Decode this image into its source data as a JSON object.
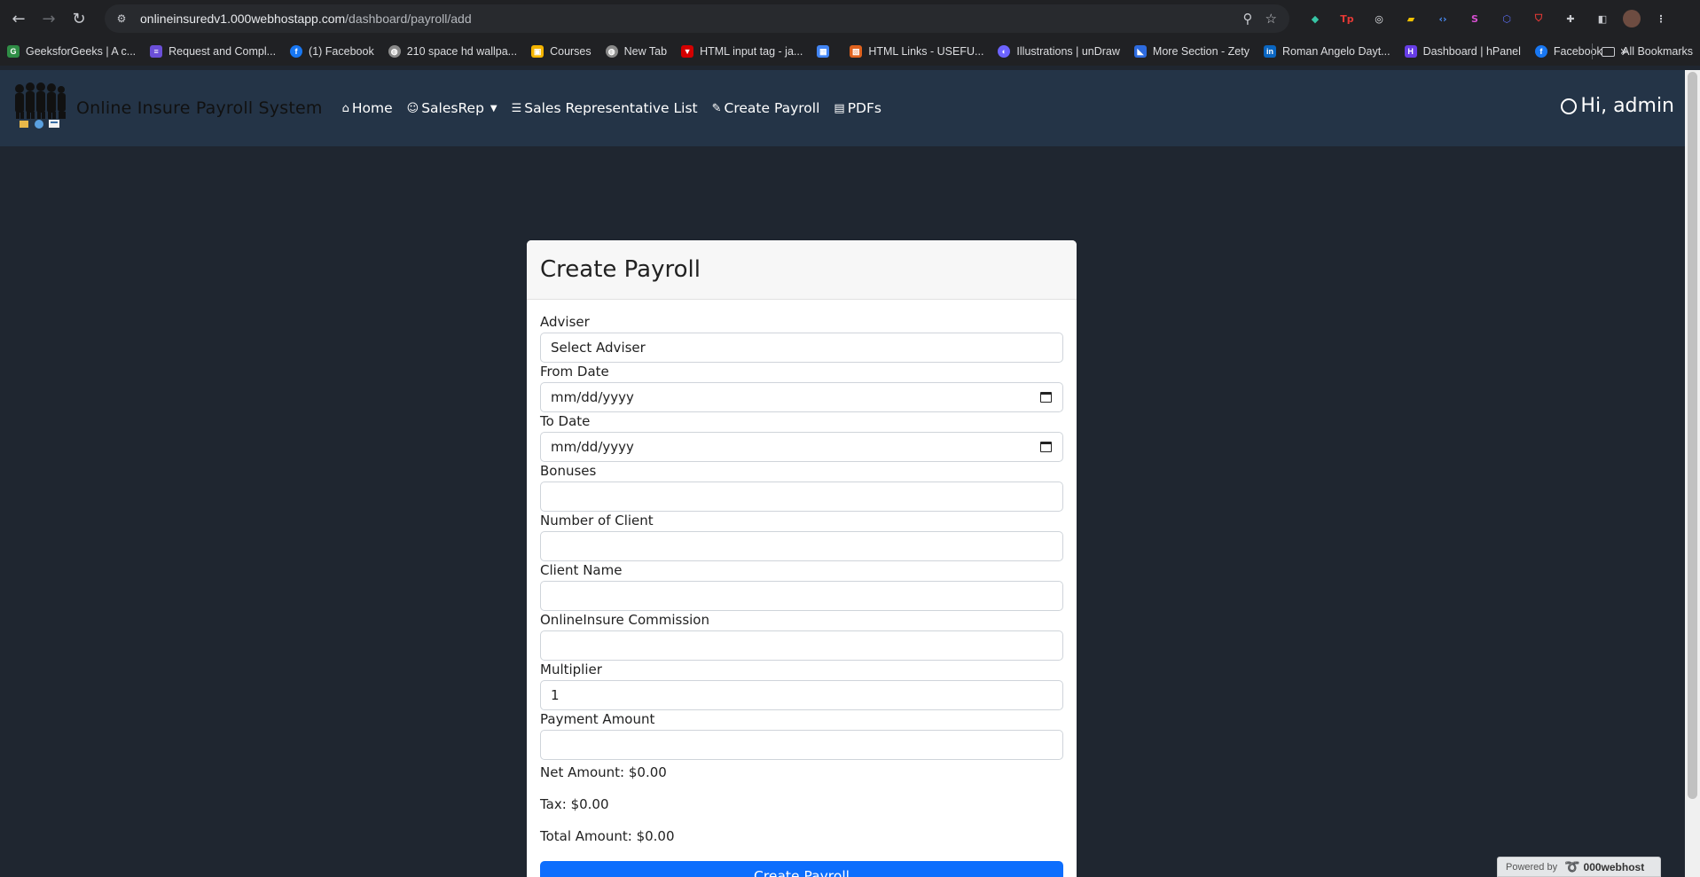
{
  "browser": {
    "url_host": "onlineinsuredv1.000webhostapp.com",
    "url_path": "/dashboard/payroll/add",
    "bookmarks": [
      {
        "label": "GeeksforGeeks | A c...",
        "color": "#2f8d46"
      },
      {
        "label": "Request and Compl...",
        "color": "#6b4fd8"
      },
      {
        "label": "(1) Facebook",
        "color": "#1877f2"
      },
      {
        "label": "210 space hd wallpa...",
        "color": "#8a8a8a"
      },
      {
        "label": "Courses",
        "color": "#f4b400"
      },
      {
        "label": "New Tab",
        "color": "#8a8a8a"
      },
      {
        "label": "HTML input tag - ja...",
        "color": "#d40000"
      },
      {
        "label": "",
        "color": "#4285f4"
      },
      {
        "label": "HTML Links - USEFU...",
        "color": "#e0621e"
      },
      {
        "label": "Illustrations | unDraw",
        "color": "#6c63ff"
      },
      {
        "label": "More Section - Zety",
        "color": "#2d6bdf"
      },
      {
        "label": "Roman Angelo Dayt...",
        "color": "#0a66c2"
      },
      {
        "label": "Dashboard | hPanel",
        "color": "#673de6"
      },
      {
        "label": "Facebook",
        "color": "#1877f2"
      }
    ],
    "more_label": "»",
    "all_bookmarks": "All Bookmarks"
  },
  "navbar": {
    "brand": "Online Insure Payroll System",
    "items": [
      {
        "label": "Home",
        "icon": "home-icon",
        "glyph": "⌂"
      },
      {
        "label": "SalesRep",
        "icon": "user-icon",
        "glyph": "☺"
      },
      {
        "label": "Sales Representative List",
        "icon": "list-icon",
        "glyph": "☰"
      },
      {
        "label": "Create Payroll",
        "icon": "pencil-icon",
        "glyph": "✎"
      },
      {
        "label": "PDFs",
        "icon": "file-icon",
        "glyph": "▤"
      }
    ],
    "user": "Hi, admin"
  },
  "form": {
    "title": "Create Payroll",
    "fields": {
      "adviser": {
        "label": "Adviser",
        "value": "Select Adviser"
      },
      "from_date": {
        "label": "From Date",
        "value": "mm/dd/yyyy"
      },
      "to_date": {
        "label": "To Date",
        "value": "mm/dd/yyyy"
      },
      "bonuses": {
        "label": "Bonuses",
        "value": ""
      },
      "num_clients": {
        "label": "Number of Client",
        "value": ""
      },
      "client_name": {
        "label": "Client Name",
        "value": ""
      },
      "commission": {
        "label": "OnlineInsure Commission",
        "value": ""
      },
      "multiplier": {
        "label": "Multiplier",
        "value": "1"
      },
      "payment_amount": {
        "label": "Payment Amount",
        "value": ""
      }
    },
    "net_amount": "Net Amount: $0.00",
    "tax": "Tax: $0.00",
    "total_amount": "Total Amount: $0.00",
    "submit_label": "Create Payroll"
  },
  "footer": {
    "powered_by": "Powered by",
    "host": "000webhost"
  }
}
